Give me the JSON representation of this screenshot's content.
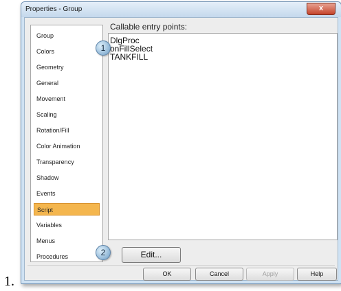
{
  "list_marker": "1.",
  "window": {
    "title": "Properties - Group",
    "close_glyph": "x"
  },
  "nav": {
    "items": [
      {
        "label": "Group",
        "selected": false
      },
      {
        "label": "Colors",
        "selected": false
      },
      {
        "label": "Geometry",
        "selected": false
      },
      {
        "label": "General",
        "selected": false
      },
      {
        "label": "Movement",
        "selected": false
      },
      {
        "label": "Scaling",
        "selected": false
      },
      {
        "label": "Rotation/Fill",
        "selected": false
      },
      {
        "label": "Color Animation",
        "selected": false
      },
      {
        "label": "Transparency",
        "selected": false
      },
      {
        "label": "Shadow",
        "selected": false
      },
      {
        "label": "Events",
        "selected": false
      },
      {
        "label": "Script",
        "selected": true
      },
      {
        "label": "Variables",
        "selected": false
      },
      {
        "label": "Menus",
        "selected": false
      },
      {
        "label": "Procedures",
        "selected": false
      }
    ]
  },
  "panel": {
    "label": "Callable entry points:",
    "entries": [
      "DlgProc",
      "onFillSelect",
      "TANKFILL"
    ],
    "edit_button": "Edit..."
  },
  "callouts": [
    "1",
    "2"
  ],
  "buttons": {
    "ok": "OK",
    "cancel": "Cancel",
    "apply": "Apply",
    "help": "Help"
  }
}
